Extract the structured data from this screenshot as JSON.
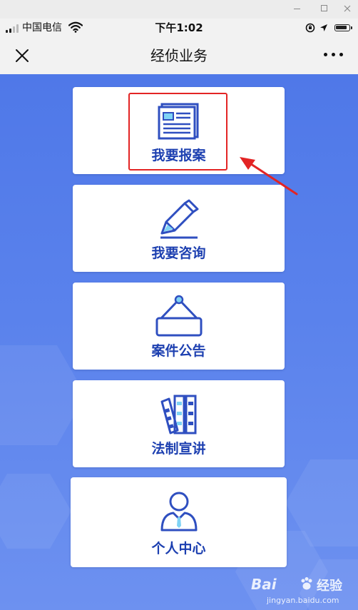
{
  "status_bar": {
    "carrier": "中国电信",
    "time": "下午1:02"
  },
  "nav": {
    "title": "经侦业务"
  },
  "menu": {
    "items": [
      {
        "label": "我要报案",
        "icon": "newspaper-icon"
      },
      {
        "label": "我要咨询",
        "icon": "pen-icon"
      },
      {
        "label": "案件公告",
        "icon": "hanging-sign-icon"
      },
      {
        "label": "法制宣讲",
        "icon": "books-icon"
      },
      {
        "label": "个人中心",
        "icon": "user-icon"
      }
    ]
  },
  "watermark": {
    "logo": "Bai",
    "logo_suffix": "经验",
    "url": "jingyan.baidu.com"
  },
  "colors": {
    "accent": "#1c3fb0",
    "icon_blue": "#2f4fc0",
    "highlight_red": "#e32424",
    "background_top": "#4f78e8",
    "background_bottom": "#6d91f0"
  }
}
